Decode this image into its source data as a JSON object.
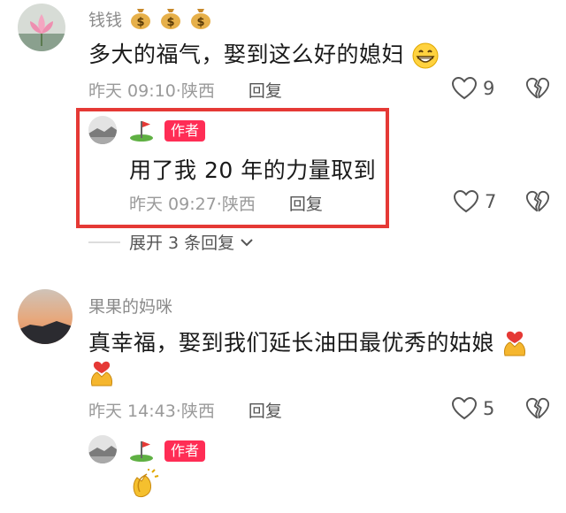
{
  "comments": [
    {
      "username": "钱钱",
      "text": "多大的福气，娶到这么好的媳妇",
      "time": "昨天 09:10",
      "location": "陕西",
      "reply_label": "回复",
      "likes": "9",
      "avatar_icon": "lotus-avatar",
      "name_emoji": "money-bag-icon"
    },
    {
      "username": "果果的妈咪",
      "text_line1": "真幸福，娶到我们延长油田最优秀的姑娘",
      "time": "昨天 14:43",
      "location": "陕西",
      "reply_label": "回复",
      "likes": "5",
      "avatar_icon": "sunset-avatar"
    }
  ],
  "author_replies": [
    {
      "badge": "作者",
      "text": "用了我 20 年的力量取到",
      "time": "昨天 09:27",
      "location": "陕西",
      "reply_label": "回复",
      "likes": "7"
    },
    {
      "badge": "作者"
    }
  ],
  "expand_label": "展开 3 条回复",
  "colors": {
    "accent": "#ff2d55",
    "highlight": "#e53935",
    "meta": "#9a9a9a"
  }
}
